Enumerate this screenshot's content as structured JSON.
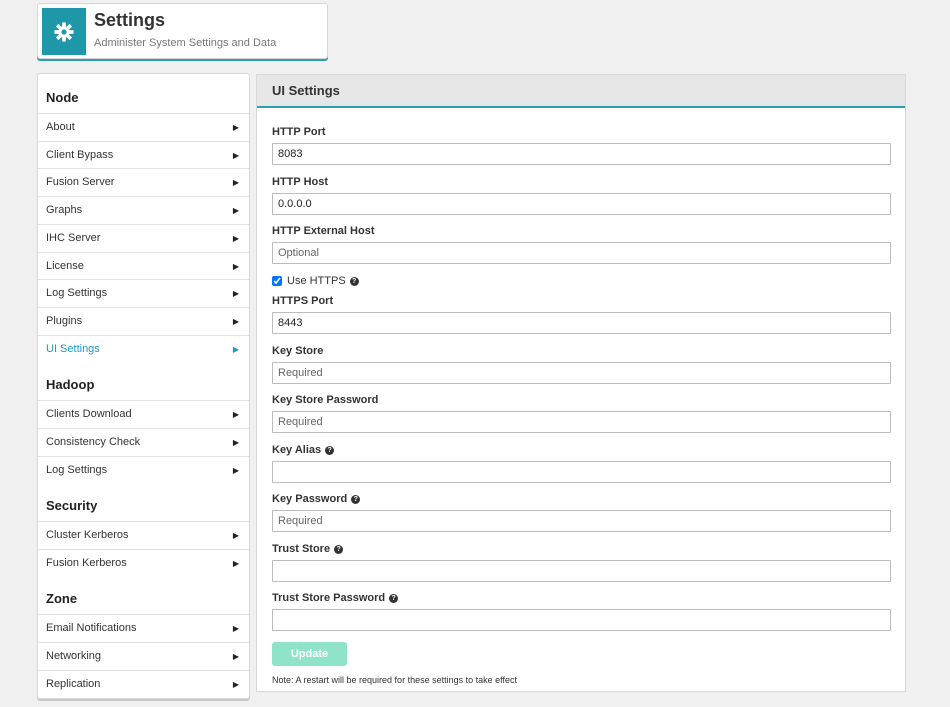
{
  "header": {
    "icon": "gear-icon",
    "title": "Settings",
    "subtitle": "Administer System Settings and Data",
    "accent": "#1e98a8"
  },
  "sidebar": {
    "sections": [
      {
        "title": "Node",
        "items": [
          "About",
          "Client Bypass",
          "Fusion Server",
          "Graphs",
          "IHC Server",
          "License",
          "Log Settings",
          "Plugins",
          "UI Settings"
        ]
      },
      {
        "title": "Hadoop",
        "items": [
          "Clients Download",
          "Consistency Check",
          "Log Settings"
        ]
      },
      {
        "title": "Security",
        "items": [
          "Cluster Kerberos",
          "Fusion Kerberos"
        ]
      },
      {
        "title": "Zone",
        "items": [
          "Email Notifications",
          "Networking",
          "Replication"
        ]
      }
    ],
    "active_item": "UI Settings",
    "active_color": "#1e98c8"
  },
  "panel": {
    "title": "UI Settings",
    "fields": {
      "http_port": {
        "label": "HTTP Port",
        "value": "8083",
        "placeholder": ""
      },
      "http_host": {
        "label": "HTTP Host",
        "value": "0.0.0.0",
        "placeholder": ""
      },
      "http_external_host": {
        "label": "HTTP External Host",
        "value": "",
        "placeholder": "Optional"
      },
      "use_https": {
        "label": "Use HTTPS",
        "checked": true
      },
      "https_port": {
        "label": "HTTPS Port",
        "value": "8443",
        "placeholder": ""
      },
      "key_store": {
        "label": "Key Store",
        "value": "",
        "placeholder": "Required"
      },
      "key_store_password": {
        "label": "Key Store Password",
        "value": "",
        "placeholder": "Required"
      },
      "key_alias": {
        "label": "Key Alias",
        "value": "",
        "placeholder": ""
      },
      "key_password": {
        "label": "Key Password",
        "value": "",
        "placeholder": "Required"
      },
      "trust_store": {
        "label": "Trust Store",
        "value": "",
        "placeholder": ""
      },
      "trust_store_password": {
        "label": "Trust Store Password",
        "value": "",
        "placeholder": ""
      }
    },
    "update_label": "Update",
    "note": "Note: A restart will be required for these settings to take effect",
    "button_color": "#8fe3c9"
  }
}
